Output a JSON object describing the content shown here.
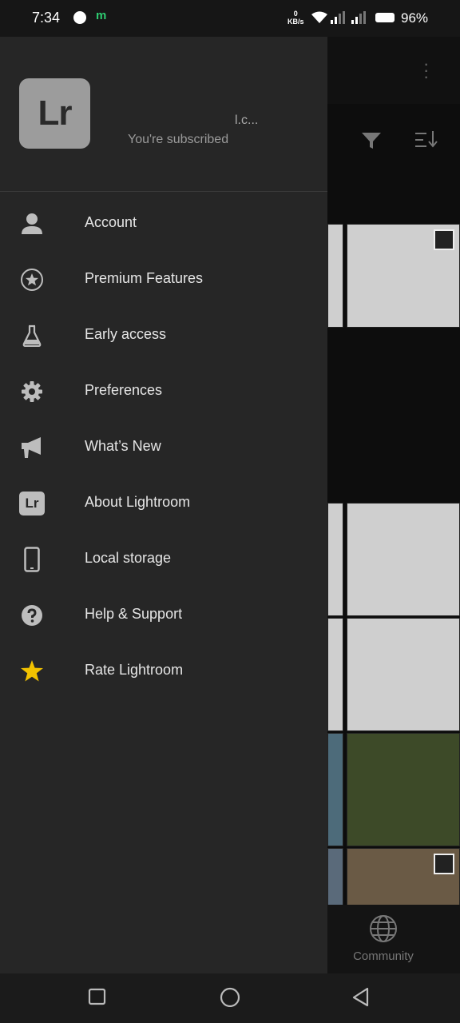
{
  "status_bar": {
    "time": "7:34",
    "notification_icons": [
      "messenger-icon",
      "m-icon"
    ],
    "m_label": "m",
    "net_speed_value": "0",
    "net_speed_unit": "KB/s",
    "battery": "96%"
  },
  "drawer": {
    "logo_text": "Lr",
    "username": "l.c...",
    "subscription_status": "You're subscribed",
    "menu": [
      {
        "label": "Account",
        "icon": "person-icon"
      },
      {
        "label": "Premium Features",
        "icon": "star-circle-icon"
      },
      {
        "label": "Early access",
        "icon": "flask-icon"
      },
      {
        "label": "Preferences",
        "icon": "gear-icon"
      },
      {
        "label": "What’s New",
        "icon": "megaphone-icon"
      },
      {
        "label": "About Lightroom",
        "icon": "lr-badge-icon"
      },
      {
        "label": "Local storage",
        "icon": "phone-icon"
      },
      {
        "label": "Help & Support",
        "icon": "help-icon"
      },
      {
        "label": "Rate Lightroom",
        "icon": "star-icon"
      }
    ],
    "about_icon_text": "Lr"
  },
  "background": {
    "community_label": "Community"
  },
  "colors": {
    "drawer_bg": "#262626",
    "rate_star": "#f2c200",
    "icon_gray": "#bdbdbd"
  }
}
